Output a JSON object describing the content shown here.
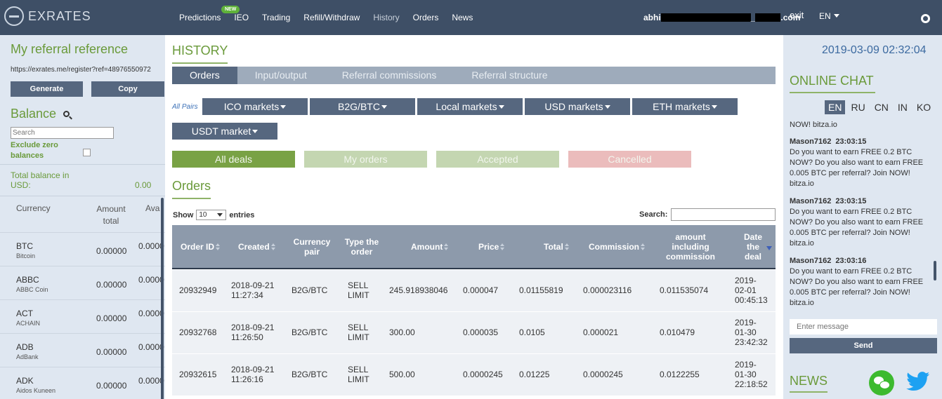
{
  "brand": {
    "name": "EXRATES"
  },
  "nav": {
    "items": [
      "Predictions",
      "IEO",
      "Trading",
      "Refill/Withdraw",
      "History",
      "Orders",
      "News"
    ],
    "new_badge": "NEW",
    "user_prefix": "abhi",
    "user_suffix": "_",
    "user_tld": ".com",
    "exit": "exit",
    "lang": "EN"
  },
  "referral": {
    "title": "My referral reference",
    "link": "https://exrates.me/register?ref=48976550972",
    "generate": "Generate",
    "copy": "Copy"
  },
  "balance": {
    "title": "Balance",
    "search_placeholder": "Search",
    "exclude_zero": "Exclude zero balances",
    "total_label": "Total balance in USD:",
    "total_value": "0.00",
    "headers": {
      "currency": "Currency",
      "amount": "Amount total",
      "available": "Ava"
    },
    "rows": [
      {
        "symbol": "BTC",
        "name": "Bitcoin",
        "amount": "0.00000",
        "available": "0.0000"
      },
      {
        "symbol": "ABBC",
        "name": "ABBC Coin",
        "amount": "0.00000",
        "available": "0.0000"
      },
      {
        "symbol": "ACT",
        "name": "ACHAIN",
        "amount": "0.00000",
        "available": "0.0000"
      },
      {
        "symbol": "ADB",
        "name": "AdBank",
        "amount": "0.00000",
        "available": "0.0000"
      },
      {
        "symbol": "ADK",
        "name": "Aidos Kuneen",
        "amount": "0.00000",
        "available": "0.0000"
      }
    ]
  },
  "history": {
    "title": "HISTORY",
    "tabs": [
      "Orders",
      "Input/output",
      "Referral commissions",
      "Referral structure"
    ],
    "all_pairs": "All Pairs",
    "markets": [
      "ICO markets",
      "B2G/BTC",
      "Local markets",
      "USD markets",
      "ETH markets",
      "USDT market"
    ],
    "filters": [
      "All deals",
      "My orders",
      "Accepted",
      "Cancelled"
    ],
    "filter_colors": [
      "#79a245",
      "#c4d6b1",
      "#c4d6b1",
      "#ebbcbc"
    ]
  },
  "orders": {
    "title": "Orders",
    "show": "Show",
    "entries_value": "10",
    "entries": "entries",
    "search_label": "Search:",
    "columns": [
      "Order ID",
      "Created",
      "Currency pair",
      "Type the order",
      "Amount",
      "Price",
      "Total",
      "Commission",
      "amount including commission",
      "Date the deal"
    ],
    "rows": [
      {
        "id": "20932949",
        "created_date": "2018-09-21",
        "created_time": "11:27:34",
        "pair": "B2G/BTC",
        "type1": "SELL",
        "type2": "LIMIT",
        "amount": "245.918938046",
        "price": "0.000047",
        "total": "0.01155819",
        "commission": "0.000023116",
        "amount_incl": "0.011535074",
        "deal_date": "2019-",
        "deal_md": "02-01",
        "deal_time": "00:45:13"
      },
      {
        "id": "20932768",
        "created_date": "2018-09-21",
        "created_time": "11:26:50",
        "pair": "B2G/BTC",
        "type1": "SELL",
        "type2": "LIMIT",
        "amount": "300.00",
        "price": "0.000035",
        "total": "0.0105",
        "commission": "0.000021",
        "amount_incl": "0.010479",
        "deal_date": "2019-",
        "deal_md": "01-30",
        "deal_time": "23:42:32"
      },
      {
        "id": "20932615",
        "created_date": "2018-09-21",
        "created_time": "11:26:16",
        "pair": "B2G/BTC",
        "type1": "SELL",
        "type2": "LIMIT",
        "amount": "500.00",
        "price": "0.0000245",
        "total": "0.01225",
        "commission": "0.0000245",
        "amount_incl": "0.0122255",
        "deal_date": "2019-",
        "deal_md": "01-30",
        "deal_time": "22:18:52"
      }
    ]
  },
  "right": {
    "datetime": "2019-03-09 02:32:04",
    "chat_title": "ONLINE CHAT",
    "chat_langs": [
      "EN",
      "RU",
      "CN",
      "IN",
      "KO"
    ],
    "partial_line": "NOW! bitza.io",
    "messages": [
      {
        "user": "Mason7162",
        "time": "23:03:15",
        "text": "Do you want to earn FREE 0.2 BTC NOW? Do you also want to earn FREE 0.005 BTC per referral? Join NOW! bitza.io"
      },
      {
        "user": "Mason7162",
        "time": "23:03:15",
        "text": "Do you want to earn FREE 0.2 BTC NOW? Do you also want to earn FREE 0.005 BTC per referral? Join NOW! bitza.io"
      },
      {
        "user": "Mason7162",
        "time": "23:03:16",
        "text": "Do you want to earn FREE 0.2 BTC NOW? Do you also want to earn FREE 0.005 BTC per referral? Join NOW! bitza.io"
      }
    ],
    "chat_placeholder": "Enter message",
    "send": "Send",
    "news_title": "NEWS"
  }
}
